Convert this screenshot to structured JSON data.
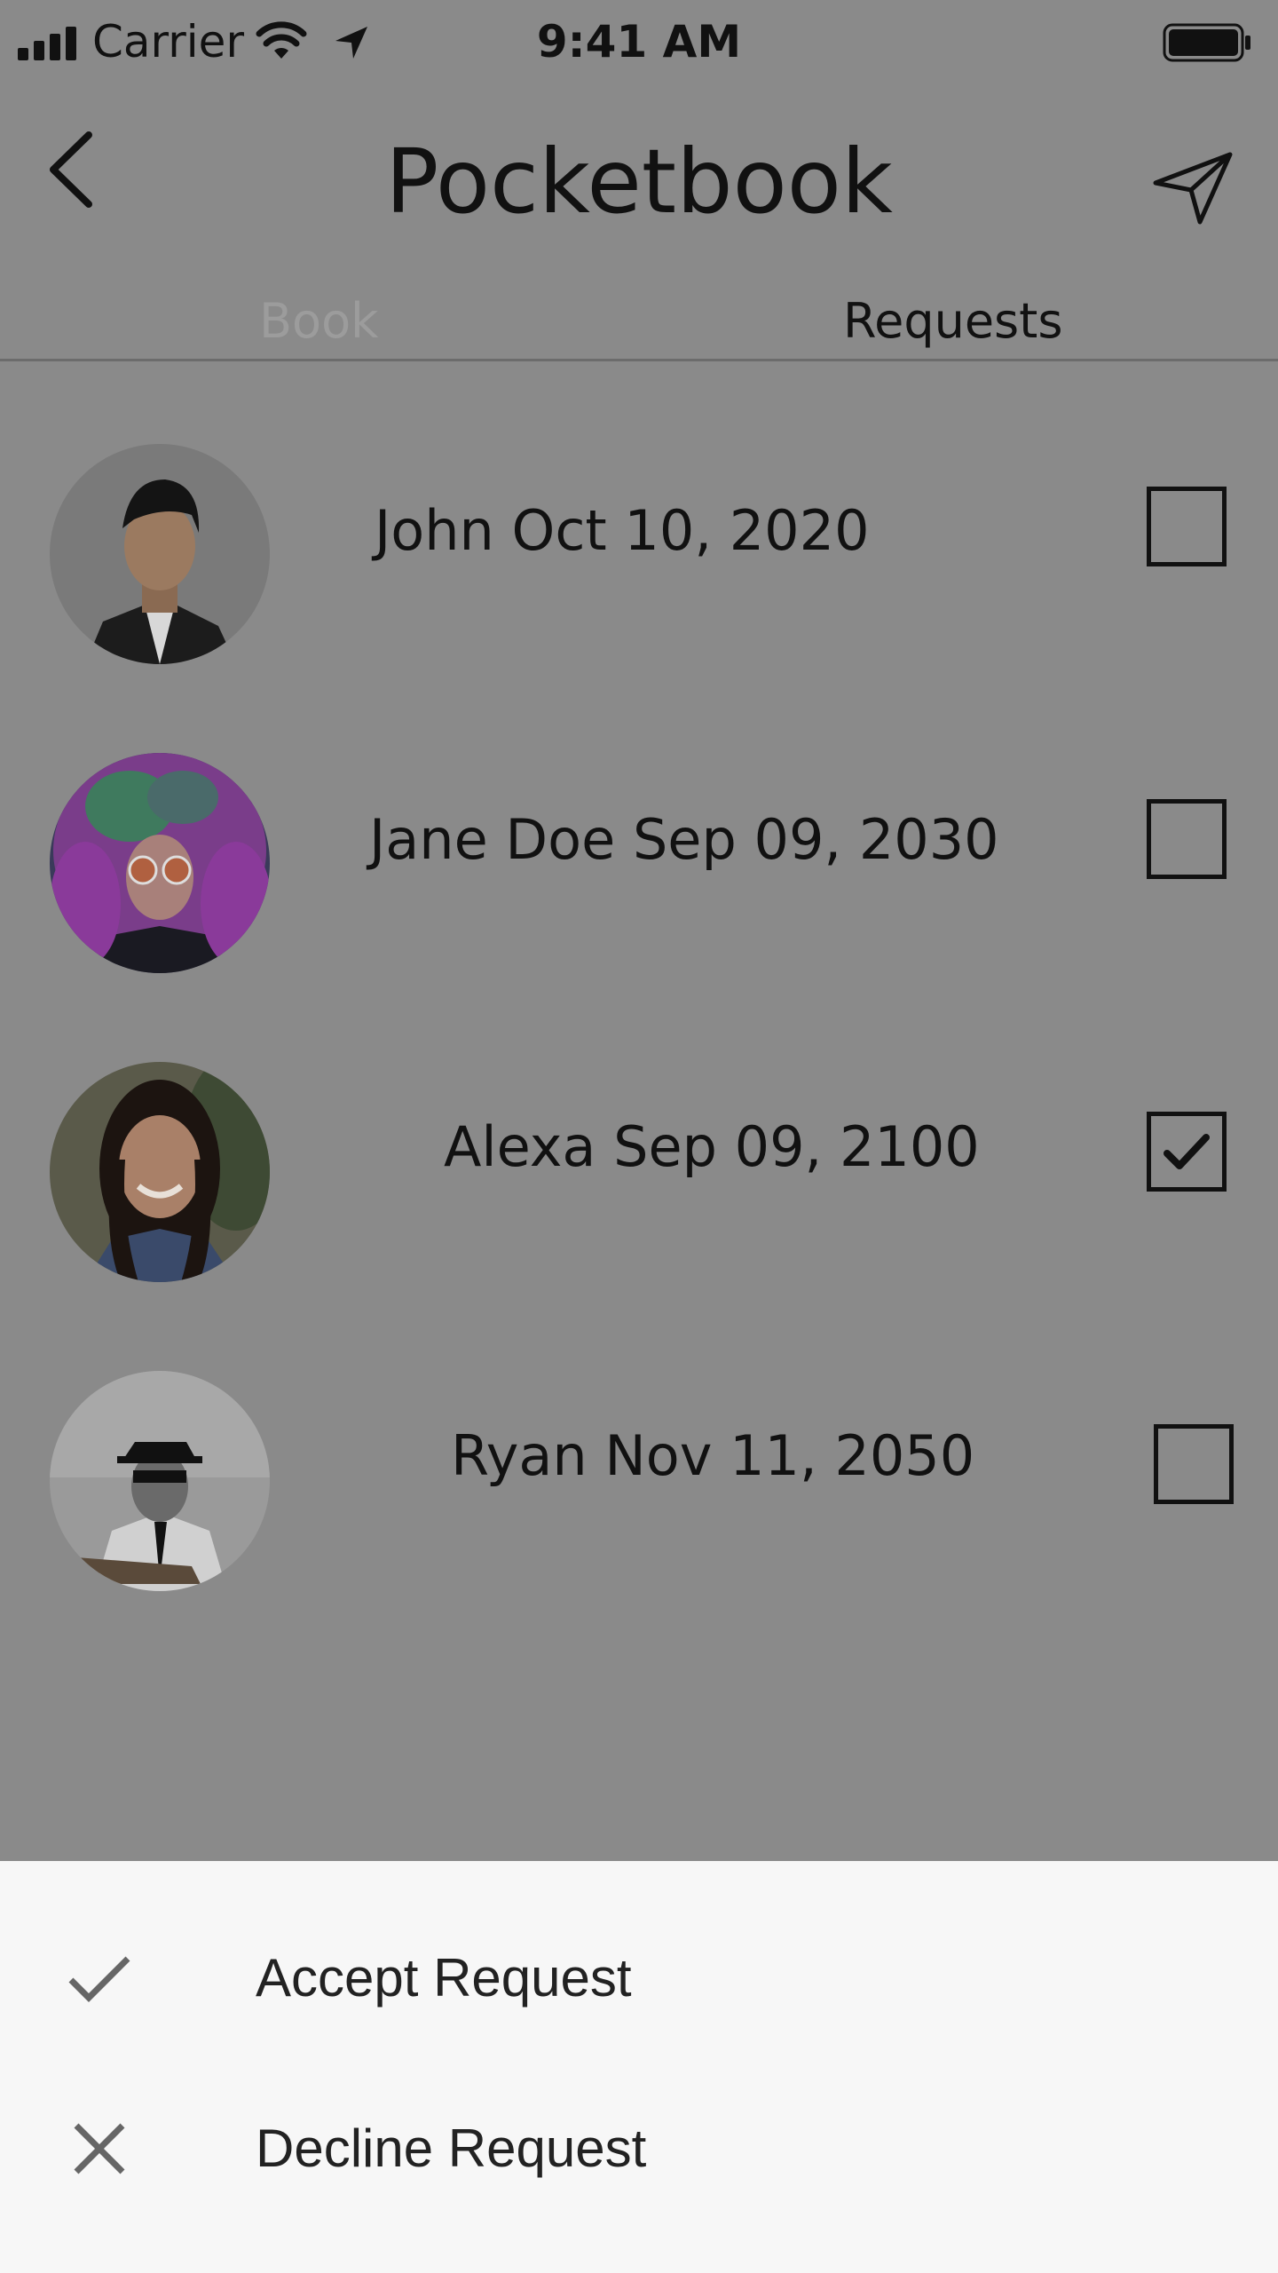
{
  "status_bar": {
    "carrier": "Carrier",
    "time": "9:41 AM"
  },
  "header": {
    "title": "Pocketbook"
  },
  "tabs": [
    {
      "label": "Book",
      "active": false
    },
    {
      "label": "Requests",
      "active": true
    }
  ],
  "requests": [
    {
      "label": "John Oct 10, 2020",
      "checked": false,
      "avatar": "john-avatar"
    },
    {
      "label": "Jane Doe Sep 09, 2030",
      "checked": false,
      "avatar": "jane-avatar"
    },
    {
      "label": "Alexa Sep 09, 2100",
      "checked": true,
      "avatar": "alexa-avatar"
    },
    {
      "label": "Ryan Nov 11, 2050",
      "checked": false,
      "avatar": "ryan-avatar"
    }
  ],
  "action_sheet": {
    "items": [
      {
        "label": "Accept Request",
        "icon": "check-icon"
      },
      {
        "label": "Decline Request",
        "icon": "close-icon"
      }
    ]
  },
  "colors": {
    "overlay": "#8a8a8a",
    "sheet_background": "#f7f7f7",
    "text": "#111111",
    "inactive_tab": "#9c9c9c"
  }
}
